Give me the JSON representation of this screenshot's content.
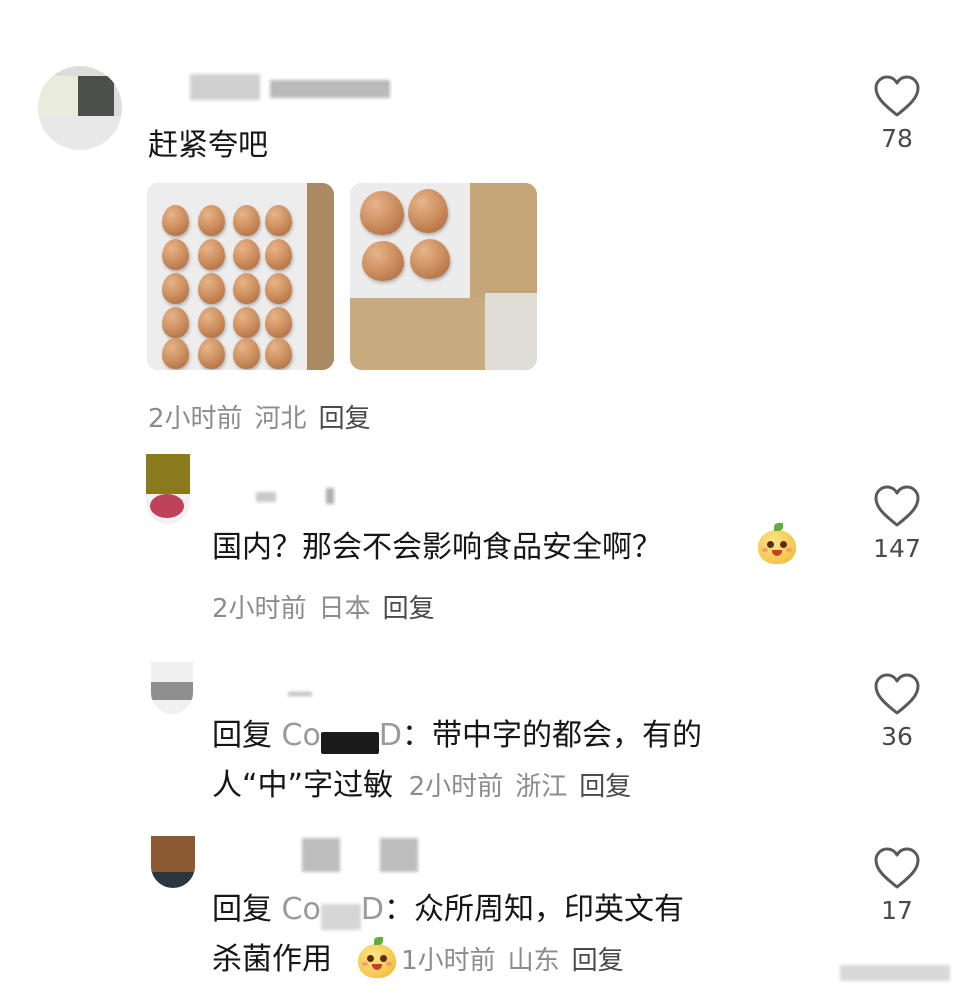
{
  "comments": [
    {
      "text": "赶紧夸吧",
      "time": "2小时前",
      "region": "河北",
      "reply_label": "回复",
      "likes": "78"
    },
    {
      "text": "国内？那会不会影响食品安全啊？",
      "time": "2小时前",
      "region": "日本",
      "reply_label": "回复",
      "likes": "147"
    },
    {
      "reply_prefix": "回复",
      "mention_start": "Co",
      "mention_end": "D",
      "text_line1": "：带中字的都会，有的",
      "text_line2": "人“中”字过敏",
      "time": "2小时前",
      "region": "浙江",
      "reply_label": "回复",
      "likes": "36"
    },
    {
      "reply_prefix": "回复",
      "mention_start": "Co",
      "mention_end": "D",
      "text_line1": "：众所周知，印英文有",
      "text_line2": "杀菌作用",
      "time": "1小时前",
      "region": "山东",
      "reply_label": "回复",
      "likes": "17"
    }
  ],
  "icons": {
    "like": "heart-outline-icon",
    "emoji": "smiling-pear-emoji"
  },
  "colors": {
    "text": "#161616",
    "meta": "#8c8c8c",
    "reply": "#4a4a4a"
  }
}
